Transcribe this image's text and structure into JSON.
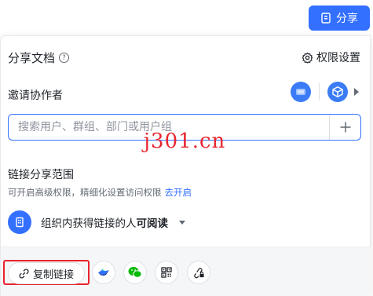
{
  "top": {
    "share_button_label": "分享"
  },
  "panel": {
    "title": "分享文档",
    "help_glyph": "?",
    "perm_settings_label": "权限设置",
    "invite_label": "邀请协作者",
    "search": {
      "placeholder": "搜索用户、群组、部门或用户组",
      "value": ""
    },
    "link_scope": {
      "label": "链接分享范围",
      "description": "可开启高级权限，精细化设置访问权限",
      "enable_link": "去开启",
      "scope_prefix": "组织内获得链接的人",
      "scope_level": "可阅读"
    },
    "bottom": {
      "copy_link_label": "复制链接"
    }
  },
  "watermark": "j301.cn",
  "colors": {
    "accent": "#3370ff",
    "highlight": "#e8232d",
    "wechat": "#09bb07",
    "text": "#1f2329"
  }
}
